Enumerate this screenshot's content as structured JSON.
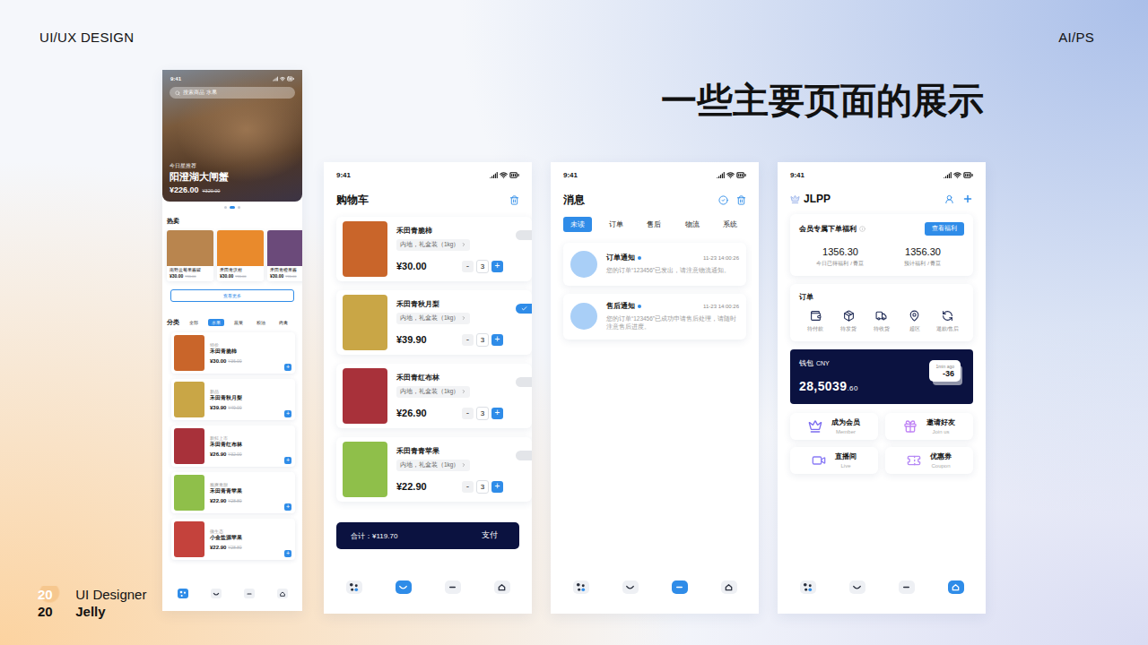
{
  "header": {
    "left": "UI/UX DESIGN",
    "right": "AI/PS"
  },
  "title": "一些主要页面的展示",
  "signature": {
    "year_top": "20",
    "role": "UI Designer",
    "year_bottom": "20",
    "name": "Jelly"
  },
  "home": {
    "time": "9:41",
    "search_placeholder": "搜索商品 水果",
    "hero": {
      "kicker": "今日星推荐",
      "title": "阳澄湖大闸蟹",
      "price": "¥226.00",
      "old_price": "¥320.00"
    },
    "carousel": [
      {
        "selected": false
      },
      {
        "selected": true
      },
      {
        "selected": false
      }
    ],
    "hot_title": "热卖",
    "hot": [
      {
        "name": "南野蓝莓果酱罐",
        "price": "¥30.00",
        "old_price": "¥36.00",
        "color": "#b9854e"
      },
      {
        "name": "禾田青沃柑",
        "price": "¥30.00",
        "old_price": "¥36.00",
        "color": "#e98a2c"
      },
      {
        "name": "禾田青橙果酱",
        "price": "¥30.00",
        "old_price": "¥36.00",
        "color": "#6b4a7a"
      }
    ],
    "more_button": "查看更多",
    "category_title": "分类",
    "categories": [
      {
        "label": "全部",
        "selected": false
      },
      {
        "label": "水果",
        "selected": true
      },
      {
        "label": "蔬菜",
        "selected": false
      },
      {
        "label": "粮油",
        "selected": false
      },
      {
        "label": "肉禽",
        "selected": false
      }
    ],
    "items": [
      {
        "tag": "特价",
        "name": "禾田青脆柿",
        "price": "¥30.00",
        "old_price": "¥36.00",
        "color": "#c9652a"
      },
      {
        "tag": "新品",
        "name": "禾田青秋月梨",
        "price": "¥39.90",
        "old_price": "¥49.00",
        "color": "#c9a646"
      },
      {
        "tag": "新鲜上市",
        "name": "禾田青红布林",
        "price": "¥26.90",
        "old_price": "¥32.00",
        "color": "#a8313a"
      },
      {
        "tag": "脆爽青甜",
        "name": "禾田青青苹果",
        "price": "¥22.90",
        "old_price": "¥28.80",
        "color": "#8fbf4a"
      },
      {
        "tag": "微生态",
        "name": "小金盐源苹果",
        "price": "¥22.90",
        "old_price": "¥28.80",
        "color": "#c4423c"
      }
    ],
    "plus": "+",
    "nav": [
      {
        "selected": true
      },
      {
        "selected": false
      },
      {
        "selected": false
      },
      {
        "selected": false
      }
    ]
  },
  "cart": {
    "time": "9:41",
    "title": "购物车",
    "items": [
      {
        "name": "禾田青脆柿",
        "spec": "内地，礼盒装（1kg）",
        "price": "¥30.00",
        "qty": "3",
        "checked": false,
        "color": "#c9652a"
      },
      {
        "name": "禾田青秋月梨",
        "spec": "内地，礼盒装（1kg）",
        "price": "¥39.90",
        "qty": "3",
        "checked": true,
        "color": "#c9a646"
      },
      {
        "name": "禾田青红布林",
        "spec": "内地，礼盒装（1kg）",
        "price": "¥26.90",
        "qty": "3",
        "checked": false,
        "color": "#a8313a"
      },
      {
        "name": "禾田青青苹果",
        "spec": "内地，礼盒装（1kg）",
        "price": "¥22.90",
        "qty": "3",
        "checked": false,
        "color": "#8fbf4a"
      }
    ],
    "minus": "-",
    "plus": "+",
    "total": "合计：¥119.70",
    "pay": "支付",
    "nav": [
      {
        "selected": false
      },
      {
        "selected": true
      },
      {
        "selected": false
      },
      {
        "selected": false
      }
    ]
  },
  "messages": {
    "time": "9:41",
    "title": "消息",
    "tabs": [
      {
        "label": "未读",
        "selected": true
      },
      {
        "label": "订单",
        "selected": false
      },
      {
        "label": "售后",
        "selected": false
      },
      {
        "label": "物流",
        "selected": false
      },
      {
        "label": "系统",
        "selected": false
      }
    ],
    "items": [
      {
        "title": "订单通知",
        "unread": true,
        "time": "11-23 14:00:26",
        "body": "您的订单“123456”已发出，请注意物流通知。"
      },
      {
        "title": "售后通知",
        "unread": true,
        "time": "11-23 14:00:26",
        "body": "您的订单“123456”已成功申请售后处理，请随时注意售后进度。"
      }
    ],
    "nav": [
      {
        "selected": false
      },
      {
        "selected": false
      },
      {
        "selected": true
      },
      {
        "selected": false
      }
    ]
  },
  "profile": {
    "time": "9:41",
    "user": "JLPP",
    "member": {
      "title": "会员专属下单福利",
      "button": "查看福利",
      "stats": [
        {
          "value": "1356.30",
          "label": "今日已得福利 / 青豆"
        },
        {
          "value": "1356.30",
          "label": "预计福利 / 青豆"
        }
      ]
    },
    "orders": {
      "title": "订单",
      "items": [
        "待付款",
        "待发货",
        "待收货",
        "超区",
        "退款/售后"
      ]
    },
    "wallet": {
      "label": "钱包",
      "currency": "CNY",
      "amount": "28,5039",
      "decimals": ".60",
      "badge_time": "1min ago",
      "badge_value": "-36"
    },
    "services": [
      {
        "title": "成为会员",
        "subtitle": "Member"
      },
      {
        "title": "邀请好友",
        "subtitle": "Join us"
      },
      {
        "title": "直播间",
        "subtitle": "Live"
      },
      {
        "title": "优惠券",
        "subtitle": "Coupon"
      }
    ],
    "nav": [
      {
        "selected": false
      },
      {
        "selected": false
      },
      {
        "selected": false
      },
      {
        "selected": true
      }
    ]
  }
}
